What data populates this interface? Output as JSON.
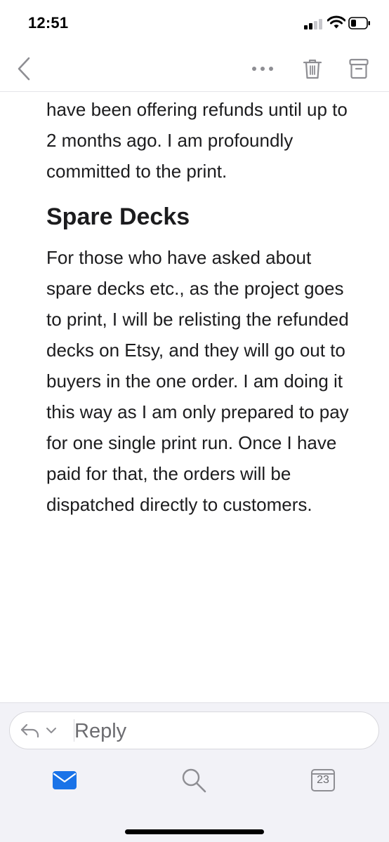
{
  "status_bar": {
    "time": "12:51",
    "signal_icon": "cellular-signal-icon",
    "wifi_icon": "wifi-icon",
    "battery_icon": "battery-icon"
  },
  "nav_bar": {
    "back_icon": "chevron-left-icon",
    "more_icon": "ellipsis-icon",
    "trash_icon": "trash-icon",
    "archive_icon": "archive-icon"
  },
  "message": {
    "intro_paragraph": "have been offering refunds until up to 2 months ago. I am profoundly committed to the print.",
    "section_heading": "Spare Decks",
    "section_paragraph": "For those who have asked about spare decks etc., as the project goes to print, I will be relisting the refunded decks on Etsy, and they will go out to buyers in the one order. I am doing it this way as I am only prepared to pay for one single print run. Once I have paid for that, the orders will be dispatched directly to customers."
  },
  "reply_bar": {
    "label": "Reply",
    "reply_icon": "reply-arrow-icon",
    "options_icon": "chevron-down-icon"
  },
  "tab_bar": {
    "mail_icon": "mail-icon",
    "search_icon": "search-icon",
    "calendar_icon": "calendar-icon",
    "calendar_day": "23",
    "active_color": "#1a73e8"
  }
}
